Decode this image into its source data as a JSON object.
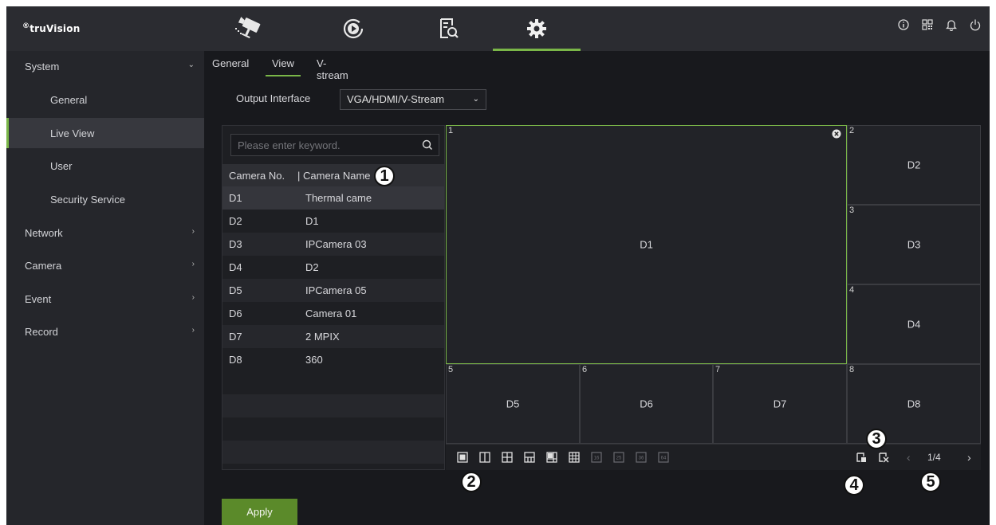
{
  "brand": {
    "logo_prefix": "®",
    "logo_text": "truVision"
  },
  "top_nav": [
    {
      "name": "live-view-camera-icon",
      "active": false
    },
    {
      "name": "playback-icon",
      "active": false
    },
    {
      "name": "search-icon",
      "active": false
    },
    {
      "name": "settings-icon",
      "active": true
    }
  ],
  "top_icons": [
    "info-icon",
    "qr-code-icon",
    "bell-icon",
    "power-icon"
  ],
  "sidebar": {
    "items": [
      {
        "label": "System",
        "level": "top",
        "chevron": "⌄"
      },
      {
        "label": "General",
        "level": "sub"
      },
      {
        "label": "Live View",
        "level": "sub",
        "active": true
      },
      {
        "label": "User",
        "level": "sub"
      },
      {
        "label": "Security Service",
        "level": "sub"
      },
      {
        "label": "Network",
        "level": "top",
        "chevron": "›"
      },
      {
        "label": "Camera",
        "level": "top",
        "chevron": "›"
      },
      {
        "label": "Event",
        "level": "top",
        "chevron": "›"
      },
      {
        "label": "Record",
        "level": "top",
        "chevron": "›"
      }
    ]
  },
  "tabs": [
    {
      "label": "General"
    },
    {
      "label": "View",
      "active": true
    },
    {
      "label": "V-stream"
    }
  ],
  "output_interface": {
    "label": "Output Interface",
    "value": "VGA/HDMI/V-Stream",
    "chevron": "⌄"
  },
  "camera_list": {
    "search_placeholder": "Please enter keyword.",
    "col_no": "Camera No.",
    "col_name": "Camera Name",
    "rows": [
      {
        "no": "D1",
        "name": "Thermal came"
      },
      {
        "no": "D2",
        "name": "D1"
      },
      {
        "no": "D3",
        "name": "IPCamera 03"
      },
      {
        "no": "D4",
        "name": "D2"
      },
      {
        "no": "D5",
        "name": "IPCamera 05"
      },
      {
        "no": "D6",
        "name": "Camera 01"
      },
      {
        "no": "D7",
        "name": "2 MPIX"
      },
      {
        "no": "D8",
        "name": "360"
      }
    ]
  },
  "view_windows": [
    {
      "num": "1",
      "label": "D1",
      "selected": true
    },
    {
      "num": "2",
      "label": "D2"
    },
    {
      "num": "3",
      "label": "D3"
    },
    {
      "num": "4",
      "label": "D4"
    },
    {
      "num": "5",
      "label": "D5"
    },
    {
      "num": "6",
      "label": "D6"
    },
    {
      "num": "7",
      "label": "D7"
    },
    {
      "num": "8",
      "label": "D8"
    }
  ],
  "toolbar": {
    "layout_buttons": [
      "layout-1-icon",
      "layout-2-icon",
      "layout-4-icon",
      "layout-6-icon",
      "layout-8-icon",
      "layout-9-icon",
      "layout-16-icon",
      "layout-25-icon",
      "layout-36-icon",
      "layout-64-icon"
    ],
    "prev": "‹",
    "next": "›",
    "page": "1/4"
  },
  "apply_label": "Apply",
  "callouts": [
    "1",
    "2",
    "3",
    "4",
    "5"
  ]
}
